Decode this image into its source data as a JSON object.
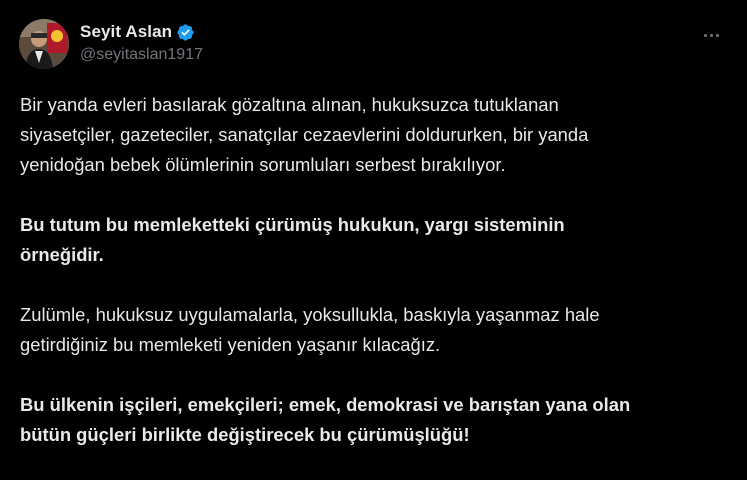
{
  "author": {
    "display_name": "Seyit Aslan",
    "handle": "@seyitaslan1917",
    "verified": true,
    "avatar_icon": "profile-photo",
    "verified_color": "#1d9bf0"
  },
  "actions": {
    "more_icon": "more-horizontal-icon"
  },
  "tweet": {
    "paragraphs": [
      {
        "text": "Bir yanda evleri basılarak gözaltına alınan, hukuksuzca tutuklanan\nsiyasetçiler, gazeteciler, sanatçılar cezaevlerini doldururken, bir yanda\nyenidoğan bebek ölümlerinin sorumluları serbest bırakılıyor.",
        "bold": false
      },
      {
        "text": "Bu tutum bu memleketteki çürümüş hukukun, yargı sisteminin\nörneğidir.",
        "bold": true
      },
      {
        "text": "Zulümle, hukuksuz uygulamalarla, yoksullukla, baskıyla yaşanmaz hale\ngetirdiğiniz bu memleketi yeniden yaşanır kılacağız.",
        "bold": false
      },
      {
        "text": "Bu ülkenin işçileri, emekçileri; emek, demokrasi ve barıştan yana olan\nbütün güçleri birlikte değiştirecek bu çürümüşlüğü!",
        "bold": true
      }
    ]
  },
  "colors": {
    "background": "#000000",
    "text_primary": "#e7e9ea",
    "text_secondary": "#71767b"
  }
}
